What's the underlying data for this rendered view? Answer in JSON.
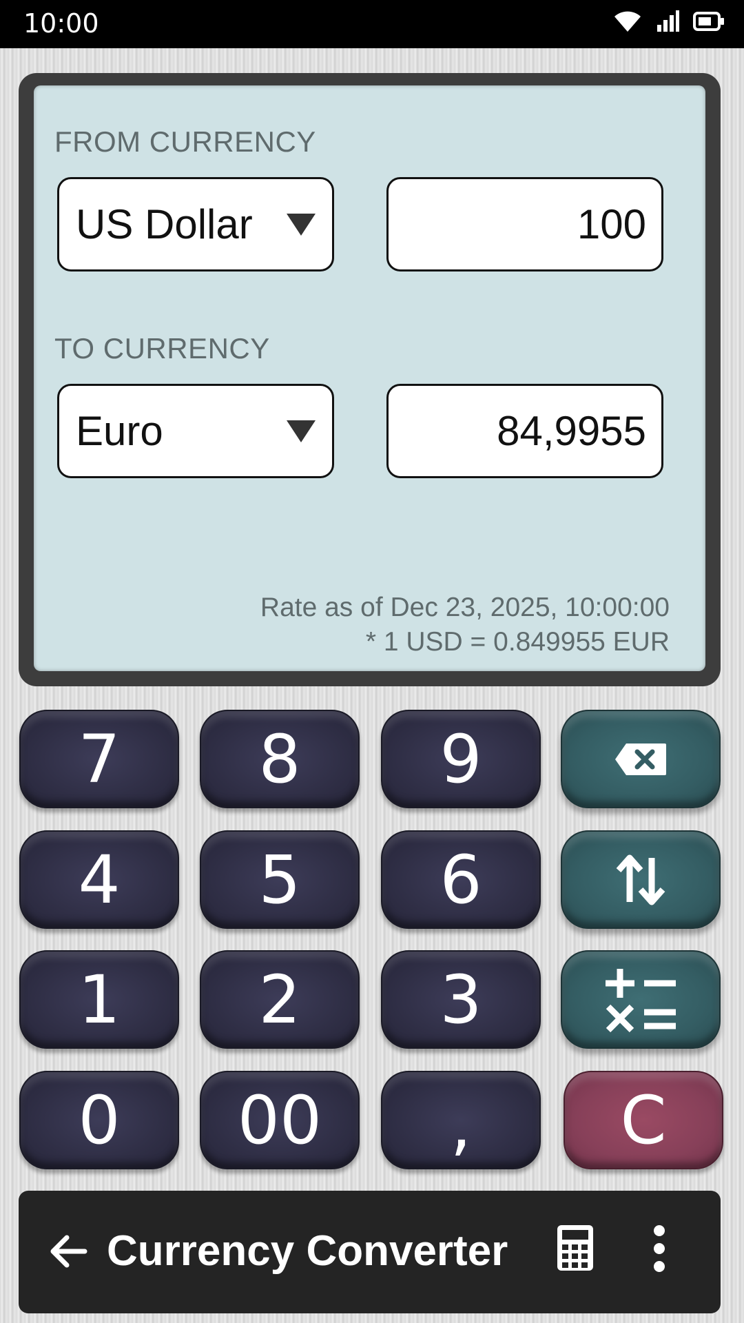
{
  "status_bar": {
    "time": "10:00"
  },
  "converter": {
    "from_label": "FROM CURRENCY",
    "from_currency": "US Dollar",
    "from_amount": "100",
    "to_label": "TO CURRENCY",
    "to_currency": "Euro",
    "to_amount": "84,9955",
    "rate_date": "Rate as of Dec 23, 2025, 10:00:00",
    "rate_value": "* 1 USD = 0.849955 EUR"
  },
  "keypad": {
    "k7": "7",
    "k8": "8",
    "k9": "9",
    "k4": "4",
    "k5": "5",
    "k6": "6",
    "k1": "1",
    "k2": "2",
    "k3": "3",
    "k0": "0",
    "k00": "00",
    "kcomma": ",",
    "kclear": "C"
  },
  "app_bar": {
    "title": "Currency Converter"
  },
  "colors": {
    "display_bg": "#cfe2e5",
    "number_key": "#2f2e45",
    "function_key": "#345d63",
    "clear_key": "#874059",
    "app_bar": "#242424"
  },
  "icons": [
    "wifi-icon",
    "signal-icon",
    "battery-icon",
    "dropdown-arrow-icon",
    "backspace-icon",
    "swap-icon",
    "operations-icon",
    "back-arrow-icon",
    "calculator-icon",
    "more-vert-icon"
  ]
}
